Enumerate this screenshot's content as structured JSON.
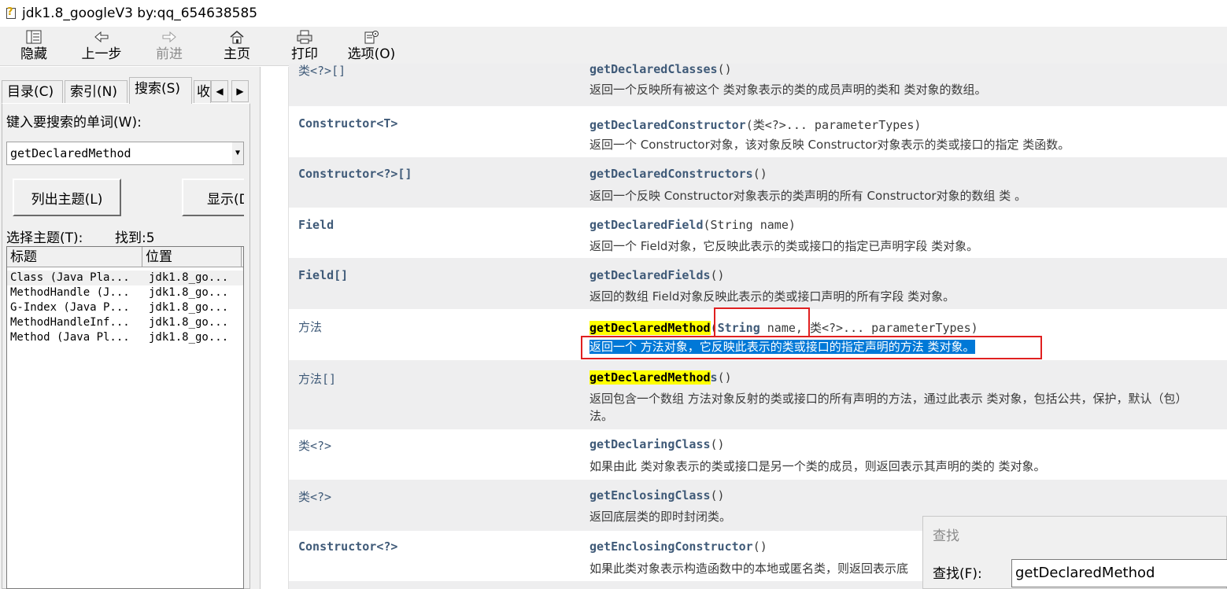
{
  "window": {
    "title": "jdk1.8_googleV3 by:qq_654638585"
  },
  "toolbar": {
    "hide": "隐藏",
    "back": "上一步",
    "forward": "前进",
    "home": "主页",
    "print": "打印",
    "options": "选项(O)"
  },
  "tabs": {
    "contents": "目录(C)",
    "index": "索引(N)",
    "search": "搜索(S)",
    "favorites": "收"
  },
  "search": {
    "prompt": "键入要搜索的单词(W):",
    "query": "getDeclaredMethod",
    "list_topics": "列出主题(L)",
    "display": "显示(D)",
    "select_topic": "选择主题(T):",
    "found": "找到:5",
    "col_title": "标题",
    "col_location": "位置",
    "results": [
      {
        "title": "Class (Java Pla...",
        "location": "jdk1.8_go..."
      },
      {
        "title": "MethodHandle (J...",
        "location": "jdk1.8_go..."
      },
      {
        "title": "G-Index (Java P...",
        "location": "jdk1.8_go..."
      },
      {
        "title": "MethodHandleInf...",
        "location": "jdk1.8_go..."
      },
      {
        "title": "Method (Java Pl...",
        "location": "jdk1.8_go..."
      }
    ]
  },
  "methods": [
    {
      "type": "类<?>[]",
      "name": "getDeclaredClasses",
      "params": "()",
      "desc": "返回一个反映所有被这个 类对象表示的类的成员声明的类和 类对象的数组。"
    },
    {
      "type": "Constructor<T>",
      "name": "getDeclaredConstructor",
      "params": "(类<?>... parameterTypes)",
      "desc": "返回一个 Constructor对象，该对象反映 Constructor对象表示的类或接口的指定 类函数。"
    },
    {
      "type": "Constructor<?>[]",
      "name": "getDeclaredConstructors",
      "params": "()",
      "desc": "返回一个反映 Constructor对象表示的类声明的所有 Constructor对象的数组 类 。"
    },
    {
      "type": "Field",
      "name": "getDeclaredField",
      "params": "(String name)",
      "desc": "返回一个 Field对象，它反映此表示的类或接口的指定已声明字段 类对象。"
    },
    {
      "type": "Field[]",
      "name": "getDeclaredFields",
      "params": "()",
      "desc": "返回的数组 Field对象反映此表示的类或接口声明的所有字段 类对象。"
    },
    {
      "type": "方法",
      "name": "getDeclaredMethod",
      "params_a": "(",
      "params_b": "String",
      "params_c": " name,",
      "params_d": " 类<?>... parameterTypes)",
      "desc": "返回一个 方法对象，它反映此表示的类或接口的指定声明的方法 类对象。"
    },
    {
      "type": "方法[]",
      "name_hl": "getDeclaredMethod",
      "name_rest": "s",
      "params": "()",
      "desc": "返回包含一个数组 方法对象反射的类或接口的所有声明的方法，通过此表示 类对象，包括公共，保护，默认（包）",
      "desc2": "法。"
    },
    {
      "type": "类<?>",
      "name": "getDeclaringClass",
      "params": "()",
      "desc": "如果由此 类对象表示的类或接口是另一个类的成员，则返回表示其声明的类的 类对象。"
    },
    {
      "type": "类<?>",
      "name": "getEnclosingClass",
      "params": "()",
      "desc": "返回底层类的即时封闭类。"
    },
    {
      "type": "Constructor<?>",
      "name": "getEnclosingConstructor",
      "params": "()",
      "desc": "如果此类对象表示构造函数中的本地或匿名类，则返回表示底"
    }
  ],
  "find": {
    "title": "查找",
    "label": "查找(F):",
    "value": "getDeclaredMethod"
  },
  "colors": {
    "highlight": "#ffff00",
    "selection": "#0078d7",
    "annotation": "#e02020",
    "type_text": "#3f5a78"
  }
}
